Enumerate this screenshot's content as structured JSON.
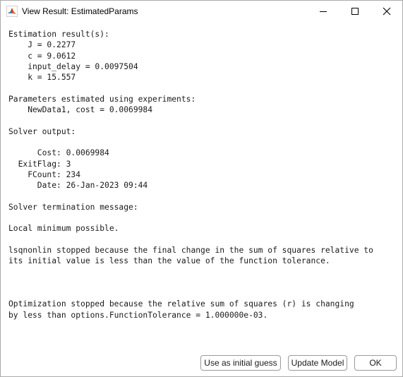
{
  "window": {
    "title": "View Result: EstimatedParams",
    "app_icon": "matlab-icon",
    "controls": {
      "minimize_icon": "minimize-icon",
      "maximize_icon": "maximize-icon",
      "close_icon": "close-icon"
    }
  },
  "result": {
    "lines": [
      "Estimation result(s):",
      "    J = 0.2277",
      "    c = 9.0612",
      "    input_delay = 0.0097504",
      "    k = 15.557",
      "",
      "Parameters estimated using experiments:",
      "    NewData1, cost = 0.0069984",
      "",
      "Solver output:",
      "",
      "      Cost: 0.0069984",
      "  ExitFlag: 3",
      "    FCount: 234",
      "      Date: 26-Jan-2023 09:44",
      "",
      "Solver termination message:",
      "",
      "Local minimum possible.",
      "",
      "lsqnonlin stopped because the final change in the sum of squares relative to",
      "its initial value is less than the value of the function tolerance.",
      "",
      "",
      "",
      "Optimization stopped because the relative sum of squares (r) is changing",
      "by less than options.FunctionTolerance = 1.000000e-03."
    ]
  },
  "buttons": {
    "initial_guess": "Use as initial guess",
    "update_model": "Update Model",
    "ok": "OK"
  }
}
